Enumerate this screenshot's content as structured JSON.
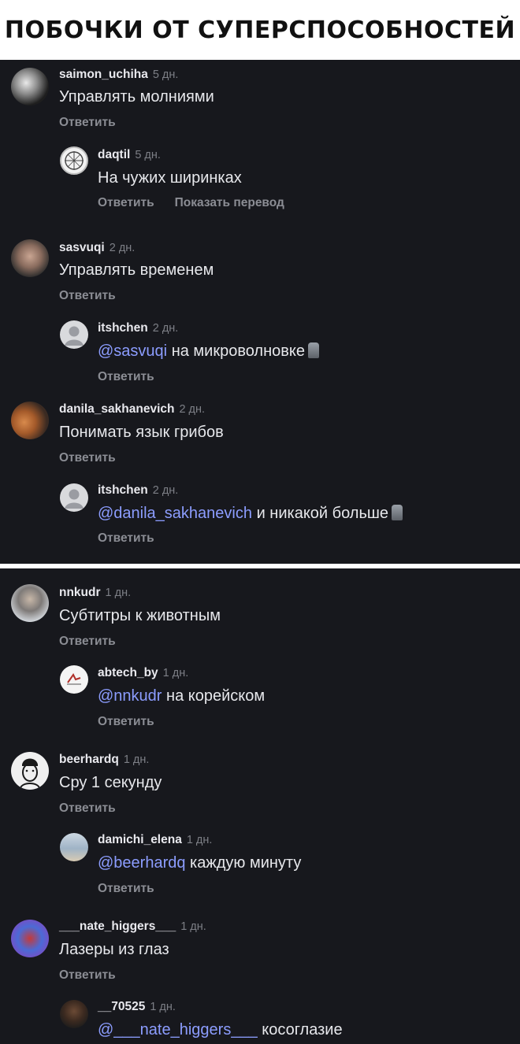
{
  "header": {
    "title": "ПОБОЧКИ ОТ СУПЕРСПОСОБНОСТЕЙ"
  },
  "colors": {
    "panel_bg": "#17181d",
    "mention": "#8c9dff",
    "text": "#e7e8ec",
    "muted": "#8b8d94"
  },
  "labels": {
    "reply": "Ответить",
    "translate": "Показать перевод"
  },
  "panel1": {
    "c1": {
      "user": "saimon_uchiha",
      "time": "5 дн.",
      "text": "Управлять молниями"
    },
    "r1": {
      "user": "daqtil",
      "time": "5 дн.",
      "text": "На чужих ширинках"
    },
    "c2": {
      "user": "sasvuqi",
      "time": "2 дн.",
      "text": "Управлять временем"
    },
    "r2": {
      "user": "itshchen",
      "time": "2 дн.",
      "mention": "@sasvuqi",
      "text": "на микроволновке",
      "emoji": "moai-emoji"
    },
    "c3": {
      "user": "danila_sakhanevich",
      "time": "2 дн.",
      "text": "Понимать язык грибов"
    },
    "r3": {
      "user": "itshchen",
      "time": "2 дн.",
      "mention": "@danila_sakhanevich",
      "text": "и никакой больше",
      "emoji": "moai-emoji"
    }
  },
  "panel2": {
    "c4": {
      "user": "nnkudr",
      "time": "1 дн.",
      "text": "Субтитры к животным"
    },
    "r4": {
      "user": "abtech_by",
      "time": "1 дн.",
      "mention": "@nnkudr",
      "text": "на корейском"
    },
    "c5": {
      "user": "beerhardq",
      "time": "1 дн.",
      "text": "Сру 1 секунду"
    },
    "r5": {
      "user": "damichi_elena",
      "time": "1 дн.",
      "mention": "@beerhardq",
      "text": "каждую минуту"
    },
    "c6": {
      "user": "___nate_higgers___",
      "time": "1 дн.",
      "text": "Лазеры из глаз"
    },
    "r6": {
      "user": "__70525",
      "time": "1 дн.",
      "mention": "@___nate_higgers___",
      "text": "косоглазие"
    }
  }
}
